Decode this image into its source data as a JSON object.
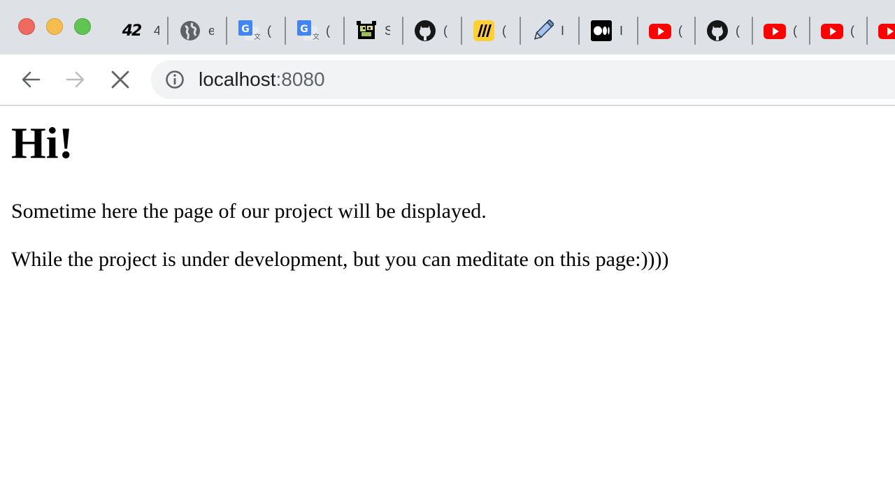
{
  "browser": {
    "tabs": [
      {
        "icon": "42-logo-icon",
        "label": "4"
      },
      {
        "icon": "globe-icon",
        "label": "e"
      },
      {
        "icon": "google-translate-icon",
        "label": "("
      },
      {
        "icon": "google-translate-icon",
        "label": "("
      },
      {
        "icon": "pixel-character-icon",
        "label": "S"
      },
      {
        "icon": "github-icon",
        "label": "("
      },
      {
        "icon": "miro-icon",
        "label": "("
      },
      {
        "icon": "pencil-icon",
        "label": "I"
      },
      {
        "icon": "medium-icon",
        "label": "I"
      },
      {
        "icon": "youtube-icon",
        "label": "("
      },
      {
        "icon": "github-icon",
        "label": "("
      },
      {
        "icon": "youtube-icon",
        "label": "("
      },
      {
        "icon": "youtube-icon",
        "label": "("
      },
      {
        "icon": "youtube-icon",
        "label": ""
      }
    ],
    "logo_text": "42",
    "address": {
      "host": "localhost",
      "port": ":8080"
    },
    "colors": {
      "tabstrip": "#dee1e6",
      "youtube": "#ff0000",
      "miro": "#ffd02f",
      "google_blue": "#4285f4"
    }
  },
  "page": {
    "heading": "Hi!",
    "paragraph1": "Sometime here the page of our project will be displayed.",
    "paragraph2": "While the project is under development, but you can meditate on this page:))))"
  }
}
